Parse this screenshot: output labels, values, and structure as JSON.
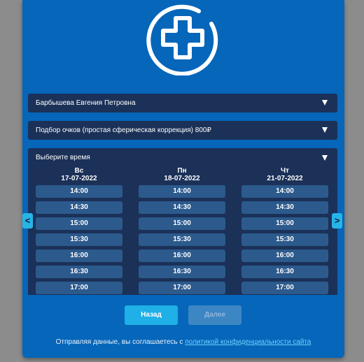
{
  "doctor_select": {
    "value": "Барбышева Евгения Петровна"
  },
  "service_select": {
    "value": "Подбор очков (простая сферическая коррекция) 800₽"
  },
  "time_select": {
    "label": "Выберите время",
    "days": [
      {
        "weekday": "Вс",
        "date": "17-07-2022",
        "slots": [
          "14:00",
          "14:30",
          "15:00",
          "15:30",
          "16:00",
          "16:30",
          "17:00"
        ]
      },
      {
        "weekday": "Пн",
        "date": "18-07-2022",
        "slots": [
          "14:00",
          "14:30",
          "15:00",
          "15:30",
          "16:00",
          "16:30",
          "17:00"
        ]
      },
      {
        "weekday": "Чт",
        "date": "21-07-2022",
        "slots": [
          "14:00",
          "14:30",
          "15:00",
          "15:30",
          "16:00",
          "16:30",
          "17:00"
        ]
      }
    ],
    "prev_label": "<",
    "next_label": ">"
  },
  "buttons": {
    "back": "Назад",
    "next": "Далее"
  },
  "consent": {
    "text": "Отправляя данные, вы соглашаетесь с ",
    "link": "политикой конфиденциальности сайта"
  },
  "colors": {
    "panel": "#0566ba",
    "dropdown": "#1b3158",
    "slot": "#2c5a8d",
    "accent": "#1eb0e6"
  },
  "icons": {
    "logo": "medical-cross-icon",
    "dropdown": "triangle-down-icon"
  }
}
